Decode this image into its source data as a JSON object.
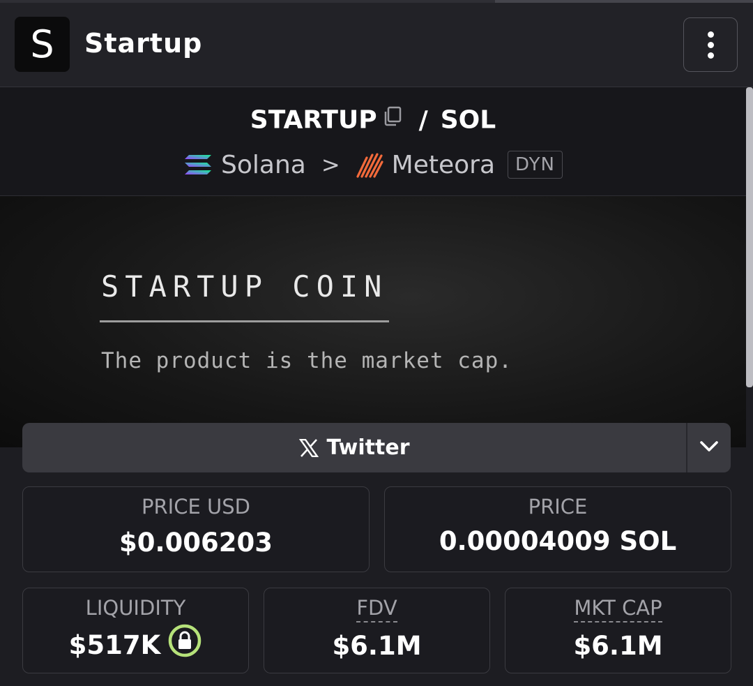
{
  "header": {
    "logo_letter": "S",
    "title": "Startup"
  },
  "pair": {
    "base": "STARTUP",
    "quote": "SOL",
    "separator": "/"
  },
  "chain": {
    "network": "Solana",
    "dex": "Meteora",
    "badge": "DYN",
    "arrow": ">"
  },
  "banner": {
    "title": "STARTUP COIN",
    "tagline": "The product is the market cap."
  },
  "social": {
    "twitter_label": "Twitter"
  },
  "stats": {
    "price_usd": {
      "label": "PRICE USD",
      "value": "$0.006203"
    },
    "price": {
      "label": "PRICE",
      "value": "0.00004009 SOL"
    },
    "liquidity": {
      "label": "LIQUIDITY",
      "value": "$517K"
    },
    "fdv": {
      "label": "FDV",
      "value": "$6.1M"
    },
    "mkt_cap": {
      "label": "MKT CAP",
      "value": "$6.1M"
    }
  },
  "colors": {
    "background": "#1d1d22",
    "lock_ring": "#b6e27a",
    "meteora": "#f36a3b"
  },
  "icons": [
    "menu-dots-icon",
    "copy-icon",
    "solana-icon",
    "chevron-right-icon",
    "meteora-icon",
    "x-logo-icon",
    "chevron-down-icon",
    "lock-icon"
  ]
}
